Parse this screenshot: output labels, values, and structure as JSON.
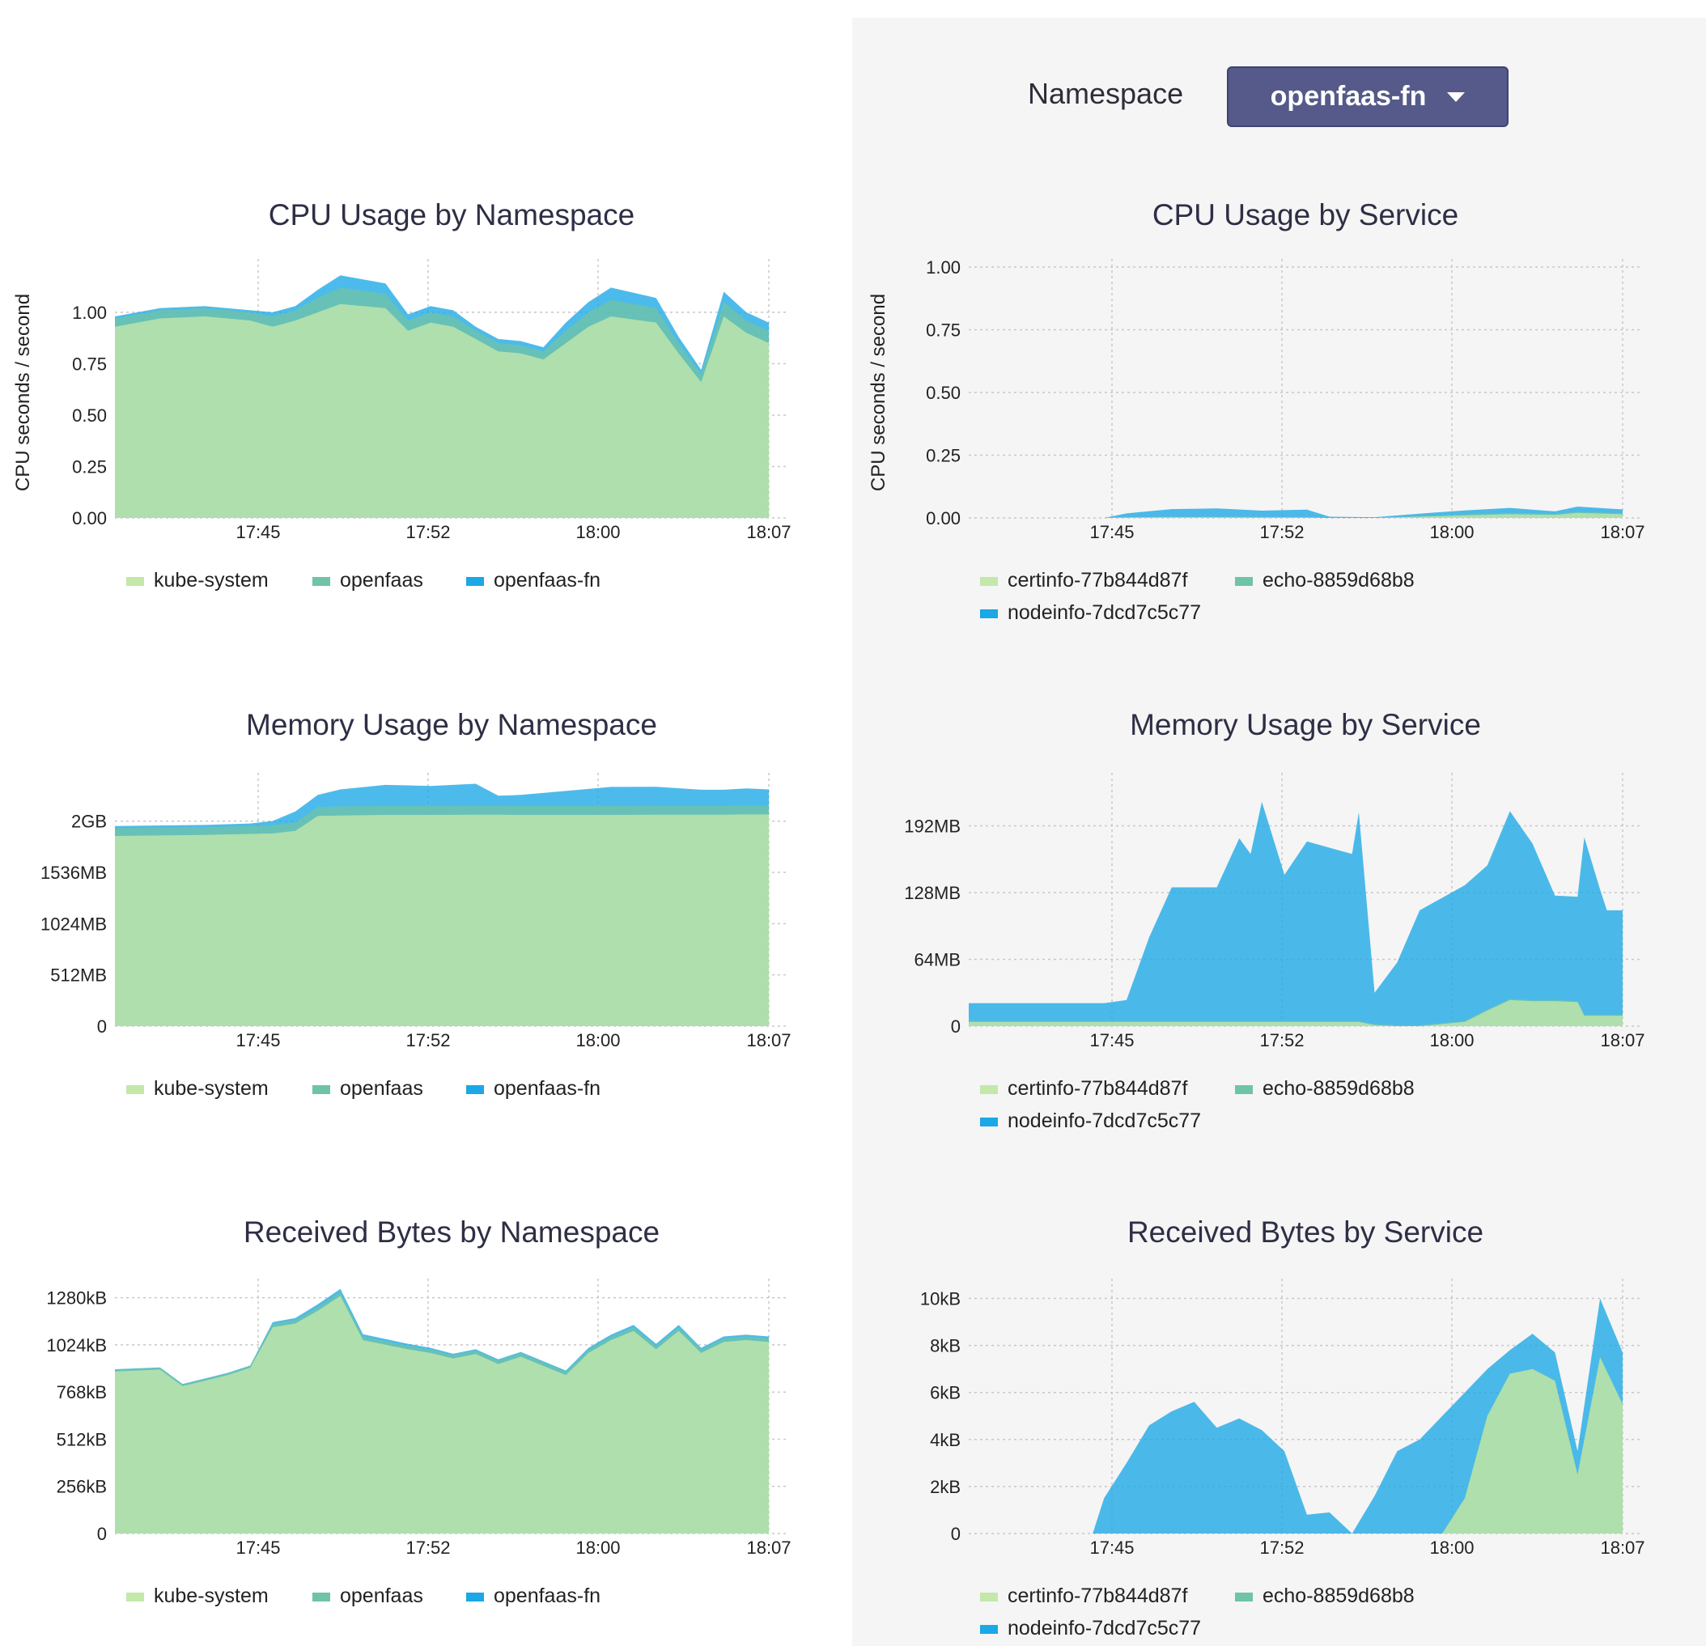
{
  "namespace": {
    "label": "Namespace",
    "selected": "openfaas-fn"
  },
  "colors": {
    "certinfo-77b844d87f": "#c4e8a9",
    "echo-8859d68b8": "#6fc3a8",
    "nodeinfo-7dcd7c5c77": "#1aa8e6",
    "kube-system": "#c4e8a9",
    "openfaas": "#6fc3a8",
    "openfaas-fn": "#1aa8e6"
  },
  "chart_data": [
    {
      "id": "cpu-ns",
      "type": "area",
      "stacked": true,
      "title": "CPU Usage by Namespace",
      "xlabel": "",
      "ylabel": "CPU seconds / second",
      "x_ticks": [
        "17:45",
        "17:52",
        "18:00",
        "18:07"
      ],
      "y_ticks": [
        "0.00",
        "0.25",
        "0.50",
        "0.75",
        "1.00"
      ],
      "x": [
        "17:38",
        "17:40",
        "17:42",
        "17:44",
        "17:45",
        "17:46",
        "17:47",
        "17:48",
        "17:50",
        "17:51",
        "17:52",
        "17:53",
        "17:54",
        "17:55",
        "17:56",
        "17:57",
        "17:58",
        "17:59",
        "18:00",
        "18:02",
        "18:03",
        "18:04",
        "18:05",
        "18:06",
        "18:07"
      ],
      "series": [
        {
          "name": "kube-system",
          "values": [
            0.93,
            0.97,
            0.98,
            0.96,
            0.93,
            0.96,
            1.0,
            1.04,
            1.02,
            0.91,
            0.95,
            0.93,
            0.87,
            0.81,
            0.8,
            0.77,
            0.85,
            0.93,
            0.98,
            0.95,
            0.8,
            0.66,
            0.98,
            0.9,
            0.85
          ]
        },
        {
          "name": "openfaas",
          "values": [
            0.04,
            0.04,
            0.04,
            0.04,
            0.05,
            0.05,
            0.07,
            0.08,
            0.07,
            0.05,
            0.05,
            0.05,
            0.04,
            0.04,
            0.04,
            0.04,
            0.06,
            0.07,
            0.08,
            0.07,
            0.05,
            0.04,
            0.07,
            0.06,
            0.06
          ]
        },
        {
          "name": "openfaas-fn",
          "values": [
            0.01,
            0.01,
            0.01,
            0.01,
            0.02,
            0.02,
            0.04,
            0.06,
            0.05,
            0.03,
            0.03,
            0.03,
            0.02,
            0.02,
            0.02,
            0.02,
            0.04,
            0.05,
            0.06,
            0.05,
            0.03,
            0.02,
            0.05,
            0.04,
            0.04
          ]
        }
      ],
      "ylim": [
        0,
        1.22
      ],
      "legend": "bottom"
    },
    {
      "id": "cpu-svc",
      "type": "area",
      "stacked": true,
      "title": "CPU Usage by Service",
      "xlabel": "",
      "ylabel": "CPU seconds / second",
      "x_ticks": [
        "17:45",
        "17:52",
        "18:00",
        "18:07"
      ],
      "y_ticks": [
        "0.00",
        "0.25",
        "0.50",
        "0.75",
        "1.00"
      ],
      "x": [
        "17:38",
        "17:42",
        "17:44",
        "17:45",
        "17:47",
        "17:49",
        "17:51",
        "17:53",
        "17:54",
        "17:56",
        "17:58",
        "18:00",
        "18:02",
        "18:04",
        "18:05",
        "18:07"
      ],
      "series": [
        {
          "name": "certinfo-77b844d87f",
          "values": [
            0,
            0,
            0,
            0.002,
            0.003,
            0.003,
            0.002,
            0.002,
            0,
            0,
            0.005,
            0.01,
            0.015,
            0.012,
            0.02,
            0.015
          ]
        },
        {
          "name": "echo-8859d68b8",
          "values": [
            0,
            0,
            0,
            0.001,
            0.002,
            0.002,
            0.002,
            0.001,
            0,
            0,
            0.002,
            0.005,
            0.005,
            0.004,
            0.005,
            0.004
          ]
        },
        {
          "name": "nodeinfo-7dcd7c5c77",
          "values": [
            0,
            0,
            0,
            0.015,
            0.03,
            0.033,
            0.025,
            0.03,
            0.005,
            0.003,
            0.01,
            0.015,
            0.02,
            0.01,
            0.02,
            0.015
          ]
        }
      ],
      "ylim": [
        0,
        1.0
      ],
      "legend": "bottom"
    },
    {
      "id": "mem-ns",
      "type": "area",
      "stacked": true,
      "title": "Memory Usage by Namespace",
      "xlabel": "",
      "ylabel": "",
      "x_ticks": [
        "17:45",
        "17:52",
        "18:00",
        "18:07"
      ],
      "y_ticks": [
        "0",
        "512MB",
        "1024MB",
        "1536MB",
        "2GB"
      ],
      "y_tick_values": [
        0,
        512,
        1024,
        1536,
        2048
      ],
      "x": [
        "17:38",
        "17:42",
        "17:44",
        "17:45",
        "17:46",
        "17:47",
        "17:48",
        "17:50",
        "17:52",
        "17:54",
        "17:55",
        "17:56",
        "17:58",
        "18:00",
        "18:02",
        "18:04",
        "18:05",
        "18:06",
        "18:07"
      ],
      "series": [
        {
          "name": "kube-system",
          "values": [
            1900,
            1910,
            1920,
            1925,
            1950,
            2100,
            2105,
            2110,
            2110,
            2112,
            2112,
            2110,
            2110,
            2110,
            2112,
            2112,
            2112,
            2115,
            2115
          ]
        },
        {
          "name": "openfaas",
          "values": [
            80,
            80,
            80,
            85,
            85,
            90,
            90,
            90,
            90,
            90,
            90,
            90,
            90,
            90,
            90,
            90,
            90,
            90,
            90
          ]
        },
        {
          "name": "openfaas-fn",
          "values": [
            20,
            20,
            25,
            40,
            110,
            120,
            170,
            210,
            200,
            220,
            100,
            110,
            150,
            190,
            190,
            160,
            160,
            170,
            160
          ]
        }
      ],
      "ylim": [
        0,
        2450
      ],
      "legend": "bottom"
    },
    {
      "id": "mem-svc",
      "type": "area",
      "stacked": true,
      "title": "Memory Usage by Service",
      "xlabel": "",
      "ylabel": "",
      "x_ticks": [
        "17:45",
        "17:52",
        "18:00",
        "18:07"
      ],
      "y_ticks": [
        "0",
        "64MB",
        "128MB",
        "192MB"
      ],
      "y_tick_values": [
        0,
        64,
        128,
        192
      ],
      "x": [
        "17:38",
        "17:44",
        "17:45",
        "17:46",
        "17:47",
        "17:49",
        "17:50",
        "17:50.5",
        "17:51",
        "17:52",
        "17:53",
        "17:55",
        "17:55.3",
        "17:56",
        "17:57",
        "17:58",
        "17:59",
        "18:00",
        "18:01",
        "18:02",
        "18:03",
        "18:04",
        "18:05",
        "18:05.3",
        "18:06",
        "18:06.3",
        "18:07"
      ],
      "series": [
        {
          "name": "certinfo-77b844d87f",
          "values": [
            4,
            4,
            4,
            4,
            4,
            4,
            4,
            4,
            4,
            4,
            4,
            4,
            4,
            1,
            0,
            0,
            2,
            4,
            15,
            25,
            24,
            24,
            23,
            10,
            10,
            10,
            10
          ]
        },
        {
          "name": "echo-8859d68b8",
          "values": [
            1,
            1,
            1,
            1,
            1,
            1,
            1,
            1,
            1,
            1,
            1,
            1,
            1,
            1,
            1,
            1,
            1,
            1,
            1,
            1,
            1,
            1,
            1,
            1,
            1,
            1,
            1
          ]
        },
        {
          "name": "nodeinfo-7dcd7c5c77",
          "values": [
            17,
            17,
            20,
            80,
            128,
            128,
            175,
            160,
            210,
            140,
            172,
            160,
            200,
            30,
            60,
            110,
            120,
            130,
            138,
            180,
            150,
            100,
            100,
            170,
            120,
            100,
            100
          ]
        }
      ],
      "ylim": [
        0,
        235
      ],
      "legend": "bottom"
    },
    {
      "id": "rx-ns",
      "type": "area",
      "stacked": true,
      "title": "Received Bytes by Namespace",
      "xlabel": "",
      "ylabel": "",
      "x_ticks": [
        "17:45",
        "17:52",
        "18:00",
        "18:07"
      ],
      "y_ticks": [
        "0",
        "256kB",
        "512kB",
        "768kB",
        "1024kB",
        "1280kB"
      ],
      "y_tick_values": [
        0,
        256,
        512,
        768,
        1024,
        1280
      ],
      "x": [
        "17:38",
        "17:40",
        "17:41",
        "17:43",
        "17:44",
        "17:45",
        "17:46",
        "17:47",
        "17:48",
        "17:49",
        "17:51",
        "17:52",
        "17:53",
        "17:54",
        "17:55",
        "17:56",
        "17:58",
        "17:59",
        "18:00",
        "18:01",
        "18:02",
        "18:03",
        "18:04",
        "18:05",
        "18:06",
        "18:07"
      ],
      "series": [
        {
          "name": "kube-system",
          "values": [
            880,
            890,
            800,
            860,
            900,
            1120,
            1140,
            1210,
            1290,
            1050,
            1000,
            980,
            950,
            975,
            920,
            960,
            860,
            980,
            1050,
            1100,
            1000,
            1100,
            980,
            1040,
            1050,
            1040
          ]
        },
        {
          "name": "openfaas",
          "values": [
            10,
            10,
            10,
            10,
            10,
            20,
            20,
            20,
            20,
            20,
            20,
            20,
            20,
            20,
            20,
            20,
            20,
            20,
            20,
            20,
            20,
            20,
            20,
            20,
            20,
            20
          ]
        },
        {
          "name": "openfaas-fn",
          "values": [
            2,
            2,
            2,
            2,
            2,
            8,
            10,
            15,
            18,
            12,
            10,
            8,
            6,
            6,
            6,
            6,
            5,
            8,
            10,
            12,
            10,
            12,
            8,
            10,
            10,
            10
          ]
        }
      ],
      "ylim": [
        0,
        1340
      ],
      "legend": "bottom"
    },
    {
      "id": "rx-svc",
      "type": "area",
      "stacked": true,
      "title": "Received Bytes by Service",
      "xlabel": "",
      "ylabel": "",
      "x_ticks": [
        "17:45",
        "17:52",
        "18:00",
        "18:07"
      ],
      "y_ticks": [
        "0",
        "2kB",
        "4kB",
        "6kB",
        "8kB",
        "10kB"
      ],
      "y_tick_values": [
        0,
        2,
        4,
        6,
        8,
        10
      ],
      "x": [
        "17:38",
        "17:43.5",
        "17:44",
        "17:45",
        "17:46",
        "17:47",
        "17:48",
        "17:49",
        "17:50",
        "17:51",
        "17:52",
        "17:53",
        "17:54",
        "17:55",
        "17:56",
        "17:57",
        "17:58",
        "17:59",
        "18:00",
        "18:01",
        "18:02",
        "18:03",
        "18:04",
        "18:05",
        "18:06",
        "18:07"
      ],
      "series": [
        {
          "name": "certinfo-77b844d87f",
          "values": [
            0,
            0,
            0,
            0,
            0,
            0,
            0,
            0,
            0,
            0,
            0,
            0,
            0,
            0,
            0,
            0,
            0,
            0,
            1.5,
            5.0,
            6.8,
            7.0,
            6.5,
            2.5,
            7.5,
            5.5
          ]
        },
        {
          "name": "echo-8859d68b8",
          "values": [
            0,
            0,
            0,
            0,
            0,
            0,
            0,
            0,
            0,
            0,
            0,
            0,
            0,
            0,
            0,
            0,
            0,
            0,
            0,
            0,
            0,
            0,
            0,
            0,
            0,
            0
          ]
        },
        {
          "name": "nodeinfo-7dcd7c5c77",
          "values": [
            0,
            0,
            1.5,
            3.0,
            4.6,
            5.2,
            5.6,
            4.5,
            4.9,
            4.4,
            3.5,
            0.8,
            0.9,
            0,
            1.6,
            3.5,
            4.0,
            5.0,
            4.5,
            2.0,
            1.0,
            1.5,
            1.2,
            1.0,
            2.5,
            2.2
          ]
        }
      ],
      "ylim": [
        0,
        10.5
      ],
      "legend": "bottom"
    }
  ],
  "layout_note": ""
}
